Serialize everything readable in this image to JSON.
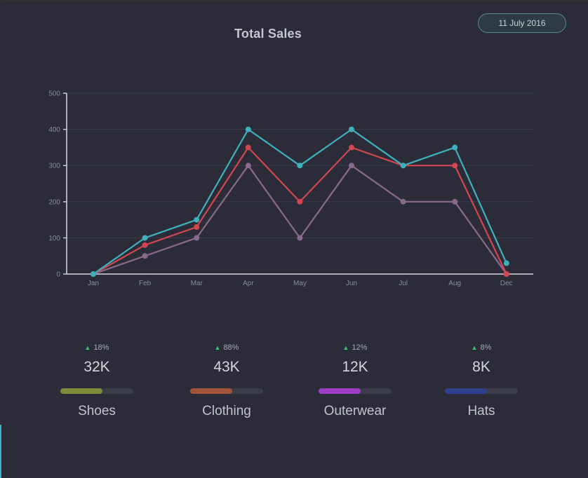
{
  "header": {
    "title": "Total Sales",
    "date": "11 July 2016"
  },
  "chart_data": {
    "type": "line",
    "title": "Total Sales",
    "categories": [
      "Jan",
      "Feb",
      "Mar",
      "Apr",
      "May",
      "Jun",
      "Jul",
      "Aug",
      "Dec"
    ],
    "ylim": [
      0,
      500
    ],
    "yticks": [
      0,
      100,
      200,
      300,
      400,
      500
    ],
    "grid": true,
    "series": [
      {
        "color": "#3fb0bd",
        "values": [
          0,
          100,
          150,
          400,
          300,
          400,
          300,
          350,
          30
        ]
      },
      {
        "color": "#d2474f",
        "values": [
          0,
          80,
          130,
          350,
          200,
          350,
          300,
          300,
          0
        ]
      },
      {
        "color": "#8a6a8c",
        "values": [
          0,
          50,
          100,
          300,
          100,
          300,
          200,
          200,
          0
        ]
      }
    ]
  },
  "stats": [
    {
      "delta": "18%",
      "value": "32K",
      "label": "Shoes",
      "progress": 0.58,
      "color": "#7a8a3a"
    },
    {
      "delta": "88%",
      "value": "43K",
      "label": "Clothing",
      "progress": 0.58,
      "color": "#a0553a"
    },
    {
      "delta": "12%",
      "value": "12K",
      "label": "Outerwear",
      "progress": 0.58,
      "color": "#9b3fc6"
    },
    {
      "delta": "8%",
      "value": "8K",
      "label": "Hats",
      "progress": 0.58,
      "color": "#2f3f8c"
    }
  ]
}
